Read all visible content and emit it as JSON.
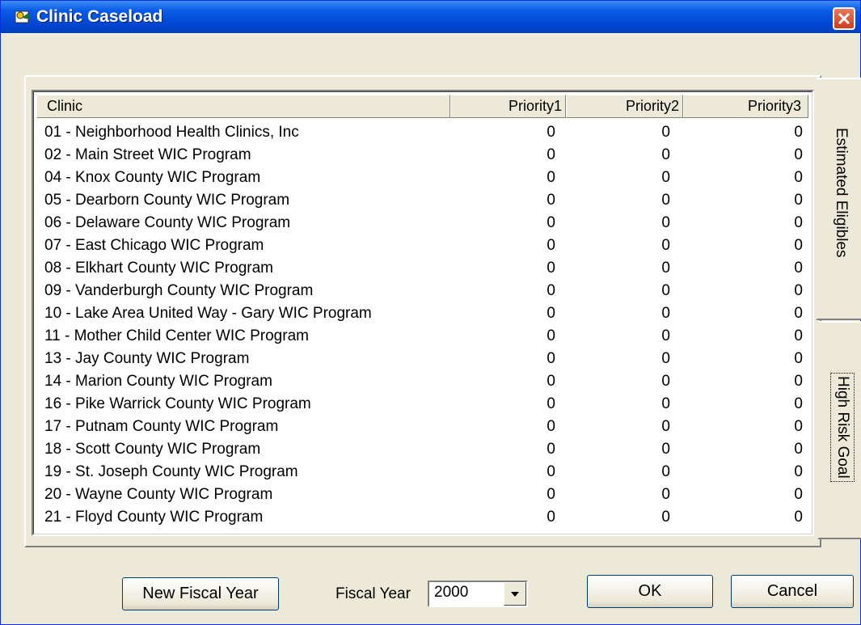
{
  "window": {
    "title": "Clinic Caseload"
  },
  "list": {
    "columns": [
      "Clinic",
      "Priority1",
      "Priority2",
      "Priority3"
    ],
    "rows": [
      {
        "clinic": "01 - Neighborhood Health Clinics, Inc",
        "p1": "0",
        "p2": "0",
        "p3": "0"
      },
      {
        "clinic": "02 - Main Street WIC Program",
        "p1": "0",
        "p2": "0",
        "p3": "0"
      },
      {
        "clinic": "04 - Knox County WIC Program",
        "p1": "0",
        "p2": "0",
        "p3": "0"
      },
      {
        "clinic": "05 - Dearborn County WIC Program",
        "p1": "0",
        "p2": "0",
        "p3": "0"
      },
      {
        "clinic": "06 - Delaware County WIC Program",
        "p1": "0",
        "p2": "0",
        "p3": "0"
      },
      {
        "clinic": "07 - East Chicago WIC Program",
        "p1": "0",
        "p2": "0",
        "p3": "0"
      },
      {
        "clinic": "08 - Elkhart County WIC Program",
        "p1": "0",
        "p2": "0",
        "p3": "0"
      },
      {
        "clinic": "09 - Vanderburgh County WIC Program",
        "p1": "0",
        "p2": "0",
        "p3": "0"
      },
      {
        "clinic": "10 - Lake Area United Way - Gary WIC Program",
        "p1": "0",
        "p2": "0",
        "p3": "0"
      },
      {
        "clinic": "11 - Mother Child Center WIC Program",
        "p1": "0",
        "p2": "0",
        "p3": "0"
      },
      {
        "clinic": "13 - Jay County WIC Program",
        "p1": "0",
        "p2": "0",
        "p3": "0"
      },
      {
        "clinic": "14 - Marion County WIC Program",
        "p1": "0",
        "p2": "0",
        "p3": "0"
      },
      {
        "clinic": "16 - Pike Warrick County WIC Program",
        "p1": "0",
        "p2": "0",
        "p3": "0"
      },
      {
        "clinic": "17 - Putnam County WIC Program",
        "p1": "0",
        "p2": "0",
        "p3": "0"
      },
      {
        "clinic": "18 - Scott County WIC Program",
        "p1": "0",
        "p2": "0",
        "p3": "0"
      },
      {
        "clinic": "19 - St. Joseph County WIC Program",
        "p1": "0",
        "p2": "0",
        "p3": "0"
      },
      {
        "clinic": "20 - Wayne County WIC Program",
        "p1": "0",
        "p2": "0",
        "p3": "0"
      },
      {
        "clinic": "21 - Floyd County WIC Program",
        "p1": "0",
        "p2": "0",
        "p3": "0"
      }
    ]
  },
  "tabs": [
    {
      "label": "Estimated Eligibles",
      "active": true
    },
    {
      "label": "High Risk Goal",
      "active": false
    }
  ],
  "footer": {
    "new_fiscal_year": "New Fiscal Year",
    "fiscal_year_label": "Fiscal Year",
    "fiscal_year_value": "2000",
    "ok": "OK",
    "cancel": "Cancel"
  },
  "icons": {
    "app": "clinic-app-icon",
    "close": "close-icon",
    "dropdown": "chevron-down-icon"
  },
  "colors": {
    "titlebar": "#0a5ce6",
    "close": "#cf3c1d",
    "dialog_bg": "#ece9d8"
  }
}
